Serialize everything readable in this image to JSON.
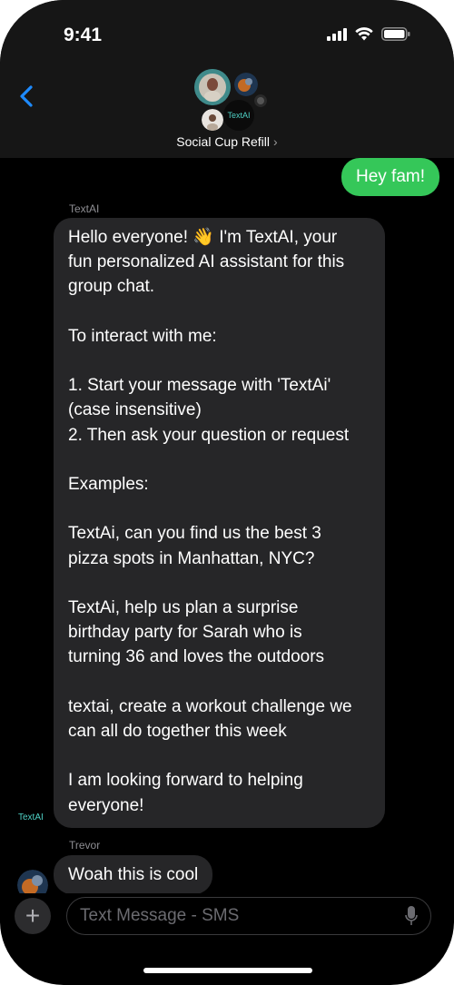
{
  "status_bar": {
    "time": "9:41"
  },
  "header": {
    "group_name": "Social Cup Refill",
    "chevron": "›",
    "avatar_label": "TextAI"
  },
  "messages": {
    "outgoing": {
      "text": "Hey fam!"
    },
    "bot": {
      "sender": "TextAI",
      "tag": "TextAI",
      "lines": [
        "Hello everyone! 👋 I'm TextAI, your",
        "fun personalized AI assistant for this",
        "group chat.",
        "",
        "To interact with me:",
        "",
        "1. Start your message with 'TextAi'",
        "(case insensitive)",
        "2. Then ask your question or request",
        "",
        "Examples:",
        "",
        "TextAi, can you find us the best 3",
        "pizza spots in Manhattan, NYC?",
        "",
        "TextAi, help us plan a surprise",
        "birthday party for Sarah who is",
        "turning 36 and loves the outdoors",
        "",
        "textai, create a workout challenge we",
        "can all do together this week",
        "",
        "I am looking forward to helping",
        "everyone!"
      ]
    },
    "trevor": {
      "sender": "Trevor",
      "text": "Woah this is cool"
    }
  },
  "composer": {
    "plus": "+",
    "placeholder": "Text Message - SMS"
  },
  "colors": {
    "outgoing_bubble": "#35c759",
    "incoming_bubble": "#262628",
    "accent_blue": "#1e8bff",
    "textai_teal": "#4fd1c5"
  }
}
